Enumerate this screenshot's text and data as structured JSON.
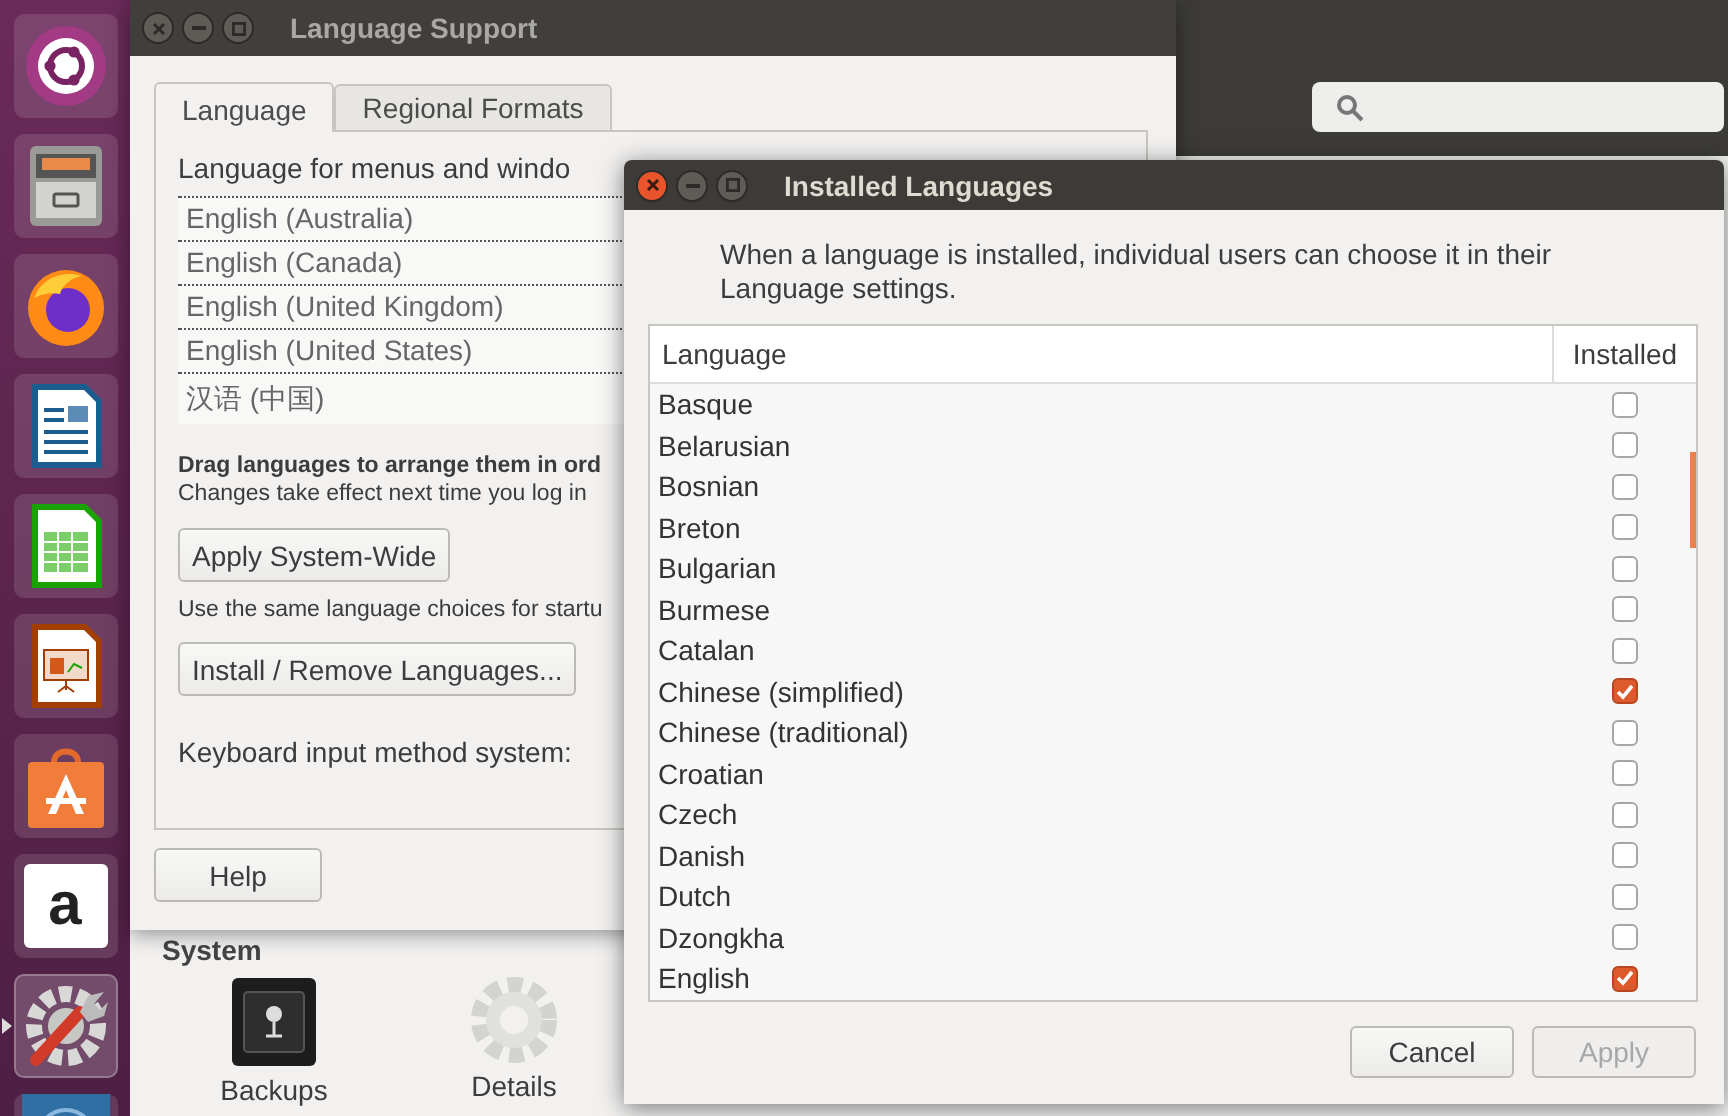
{
  "launcher": {
    "items": [
      {
        "kind": "ubuntu",
        "running": false
      },
      {
        "kind": "files",
        "running": false
      },
      {
        "kind": "browser",
        "running": false
      },
      {
        "kind": "writer",
        "running": false
      },
      {
        "kind": "calc",
        "running": false
      },
      {
        "kind": "impress",
        "running": false
      },
      {
        "kind": "software",
        "running": false
      },
      {
        "kind": "letter",
        "glyph": "a",
        "running": false
      },
      {
        "kind": "settings",
        "running": true
      },
      {
        "kind": "disc",
        "running": false
      }
    ]
  },
  "settings_window": {
    "section": "System",
    "items": [
      {
        "label": "Backups",
        "kind": "safe"
      },
      {
        "label": "Details",
        "kind": "gear"
      }
    ]
  },
  "language_support": {
    "title": "Language Support",
    "tabs": [
      {
        "label": "Language",
        "selected": true
      },
      {
        "label": "Regional Formats",
        "selected": false
      }
    ],
    "heading": "Language for menus and windo",
    "languages": [
      "English (Australia)",
      "English (Canada)",
      "English (United Kingdom)",
      "English (United States)",
      "汉语 (中国)"
    ],
    "hint_bold": "Drag languages to arrange them in ord",
    "hint": "Changes take effect next time you log in",
    "apply_button": "Apply System-Wide",
    "startup_note": "Use the same language choices for startu",
    "install_button": "Install / Remove Languages...",
    "keyboard_label": "Keyboard input method system:",
    "help_button": "Help"
  },
  "installed_languages": {
    "title": "Installed Languages",
    "description": "When a language is installed, individual users can choose it in their Language settings.",
    "columns": [
      "Language",
      "Installed"
    ],
    "rows": [
      {
        "language": "Basque",
        "installed": false
      },
      {
        "language": "Belarusian",
        "installed": false
      },
      {
        "language": "Bosnian",
        "installed": false
      },
      {
        "language": "Breton",
        "installed": false
      },
      {
        "language": "Bulgarian",
        "installed": false
      },
      {
        "language": "Burmese",
        "installed": false
      },
      {
        "language": "Catalan",
        "installed": false
      },
      {
        "language": "Chinese (simplified)",
        "installed": true
      },
      {
        "language": "Chinese (traditional)",
        "installed": false
      },
      {
        "language": "Croatian",
        "installed": false
      },
      {
        "language": "Czech",
        "installed": false
      },
      {
        "language": "Danish",
        "installed": false
      },
      {
        "language": "Dutch",
        "installed": false
      },
      {
        "language": "Dzongkha",
        "installed": false
      },
      {
        "language": "English",
        "installed": true
      }
    ],
    "buttons": [
      {
        "label": "Cancel",
        "disabled": false
      },
      {
        "label": "Apply",
        "disabled": true
      }
    ]
  }
}
